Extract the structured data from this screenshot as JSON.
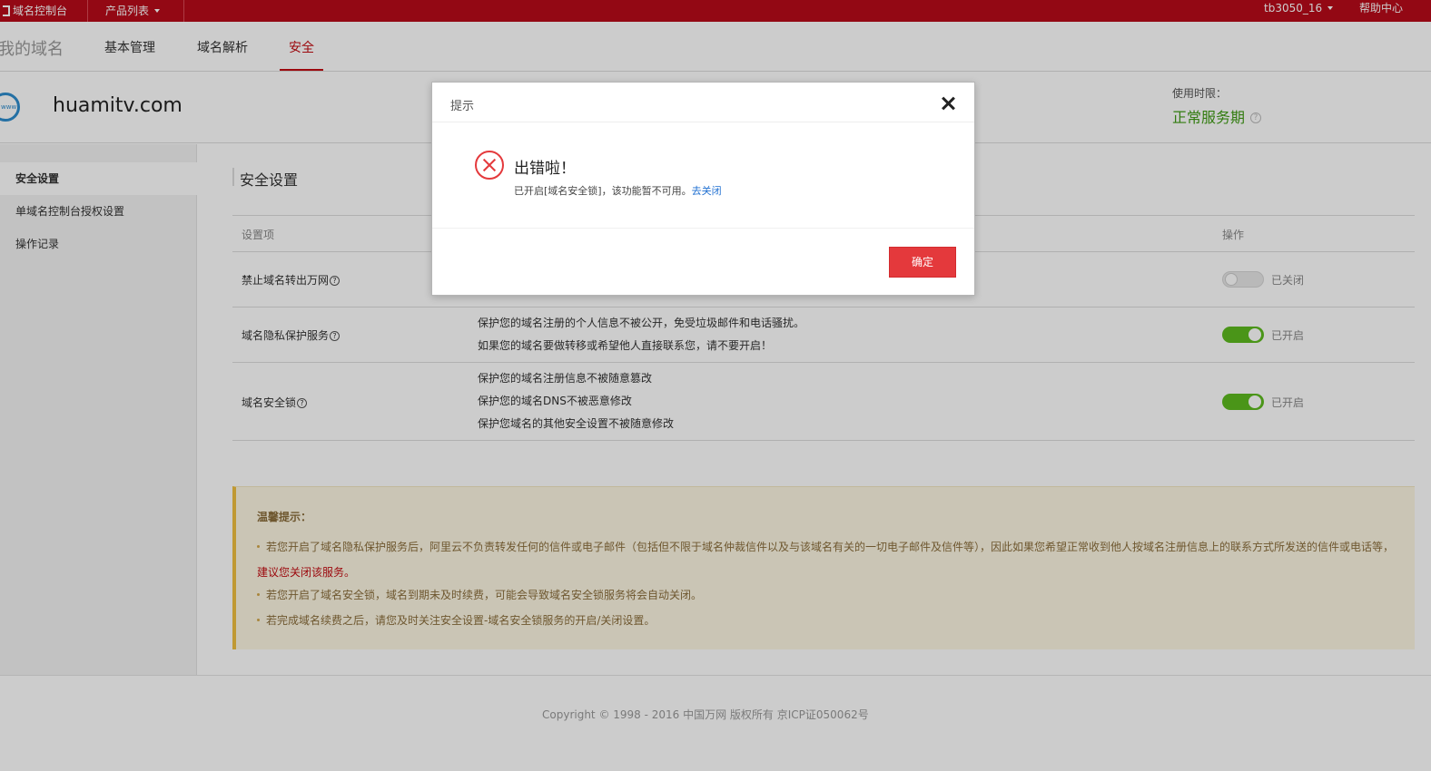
{
  "topbar": {
    "brand": "域名控制台",
    "products": "产品列表",
    "user": "tb3050_16",
    "help": "帮助中心"
  },
  "nav": {
    "crumb": "我的域名",
    "tabs": [
      "基本管理",
      "域名解析",
      "安全"
    ],
    "active_tab": "安全"
  },
  "domain": {
    "icon_text": "www",
    "name": "huamitv.com",
    "period_label": "使用时限：",
    "period_value": "正常服务期"
  },
  "sidebar": {
    "items": [
      "安全设置",
      "单域名控制台授权设置",
      "操作记录"
    ],
    "active": "安全设置"
  },
  "section": {
    "title": "安全设置"
  },
  "table": {
    "headers": [
      "设置项",
      "操作"
    ],
    "rows": [
      {
        "name": "禁止域名转出万网",
        "desc": [],
        "status": "已关闭",
        "enabled": false
      },
      {
        "name": "域名隐私保护服务",
        "desc": [
          "保护您的域名注册的个人信息不被公开，免受垃圾邮件和电话骚扰。",
          "如果您的域名要做转移或希望他人直接联系您，请不要开启！"
        ],
        "status": "已开启",
        "enabled": true
      },
      {
        "name": "域名安全锁",
        "desc": [
          "保护您的域名注册信息不被随意篡改",
          "保护您的域名DNS不被恶意修改",
          "保护您域名的其他安全设置不被随意修改"
        ],
        "status": "已开启",
        "enabled": true
      }
    ]
  },
  "tips": {
    "title": "温馨提示：",
    "line1": "若您开启了域名隐私保护服务后，阿里云不负责转发任何的信件或电子邮件（包括但不限于域名仲裁信件以及与该域名有关的一切电子邮件及信件等），因此如果您希望正常收到他人按域名注册信息上的联系方式所发送的信件或电话等，",
    "line1_red": "建议您关闭该服务。",
    "line2": "若您开启了域名安全锁，域名到期未及时续费，可能会导致域名安全锁服务将会自动关闭。",
    "line3": "若完成域名续费之后，请您及时关注安全设置-域名安全锁服务的开启/关闭设置。"
  },
  "footer": {
    "copyright": "Copyright © 1998 - 2016 中国万网 版权所有 京ICP证050062号"
  },
  "modal": {
    "title": "提示",
    "error_title": "出错啦！",
    "error_message": "已开启[域名安全锁]，该功能暂不可用。",
    "error_link": "去关闭",
    "ok_label": "确定"
  },
  "colors": {
    "topbar": "#b80a19",
    "accent": "#c40c12",
    "toggle_on": "#5dbb1f",
    "ok_button": "#e4393c",
    "period_value": "#3f9b14"
  }
}
